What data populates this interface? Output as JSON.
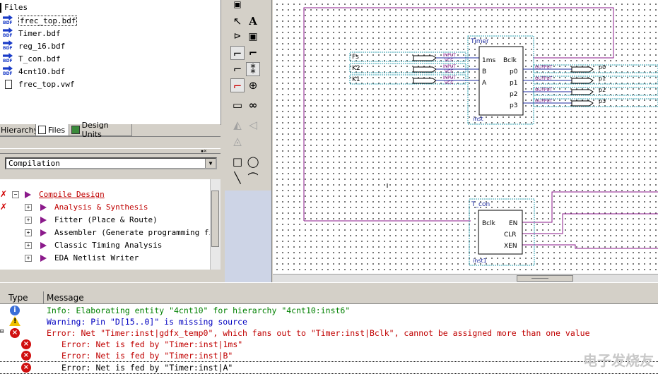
{
  "files": {
    "header": "Files",
    "items": [
      {
        "name": "frec_top.bdf",
        "type": "BDF",
        "selected": true
      },
      {
        "name": "Timer.bdf",
        "type": "BDF"
      },
      {
        "name": "reg_16.bdf",
        "type": "BDF"
      },
      {
        "name": "T_con.bdf",
        "type": "BDF"
      },
      {
        "name": "4cnt10.bdf",
        "type": "BDF"
      },
      {
        "name": "frec_top.vwf",
        "type": "vwf"
      }
    ]
  },
  "nav_tabs": [
    {
      "label": "Hierarchy"
    },
    {
      "label": "Files",
      "active": true
    },
    {
      "label": "Design Units"
    }
  ],
  "compilation": {
    "selected": "Compilation",
    "tasks": [
      {
        "label": "Compile Design",
        "error": true
      },
      {
        "label": "Analysis & Synthesis",
        "error": true
      },
      {
        "label": "Fitter (Place & Route)"
      },
      {
        "label": "Assembler (Generate programming files)"
      },
      {
        "label": "Classic Timing Analysis"
      },
      {
        "label": "EDA Netlist Writer"
      }
    ]
  },
  "schematic": {
    "inputs": [
      {
        "name": "Fs",
        "tag": "INPUT",
        "vcc": "VCC"
      },
      {
        "name": "K2",
        "tag": "INPUT",
        "vcc": "VCC"
      },
      {
        "name": "K1",
        "tag": "INPUT",
        "vcc": "VCC"
      }
    ],
    "outputs": [
      {
        "name": "p0",
        "tag": "OUTPUT"
      },
      {
        "name": "p1",
        "tag": "OUTPUT"
      },
      {
        "name": "p2",
        "tag": "OUTPUT"
      },
      {
        "name": "p3",
        "tag": "OUTPUT"
      }
    ],
    "timer": {
      "title": "Timer",
      "instance": "inst",
      "left_pins": [
        "1ms",
        "B",
        "A"
      ],
      "right_pins": [
        "Bclk",
        "p0",
        "p1",
        "p2",
        "p3"
      ]
    },
    "tcon": {
      "title": "T_con",
      "instance": "inst1",
      "left_pins": [
        "Bclk"
      ],
      "right_pins": [
        "EN",
        "CLR",
        "XEN"
      ]
    }
  },
  "messages": {
    "col_type": "Type",
    "col_message": "Message",
    "rows": [
      {
        "level": "info",
        "text": "Info: Elaborating entity \"4cnt10\" for hierarchy \"4cnt10:inst6\""
      },
      {
        "level": "warning",
        "text": "Warning: Pin \"D[15..0]\" is missing source"
      },
      {
        "level": "error",
        "text": "Error: Net \"Timer:inst|gdfx_temp0\", which fans out to \"Timer:inst|Bclk\", cannot be assigned more than one value"
      },
      {
        "level": "error-sub",
        "text": "Error: Net is fed by \"Timer:inst|1ms\""
      },
      {
        "level": "error-sub",
        "text": "Error: Net is fed by \"Timer:inst|B\""
      },
      {
        "level": "error-sub",
        "text": "Error: Net is fed by \"Timer:inst|A\""
      }
    ]
  },
  "watermark": "电子发烧友",
  "colors": {
    "wire_purple": "#8b1a8b",
    "wire_blue": "#1e2ba0",
    "symbol_box_cyan": "#2fa0b0",
    "error_red": "#c00000",
    "info_green": "#008000",
    "warn_blue": "#0000c0"
  }
}
